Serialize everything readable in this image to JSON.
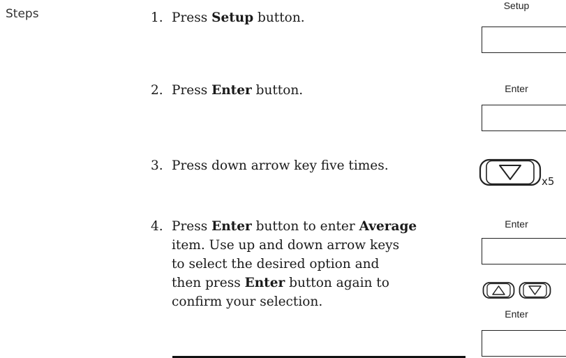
{
  "section": {
    "label": "Steps"
  },
  "steps": [
    {
      "number": "1.",
      "text_parts": [
        "Press ",
        "Setup",
        " button."
      ]
    },
    {
      "number": "2.",
      "text_parts": [
        "Press ",
        "Enter",
        " button."
      ]
    },
    {
      "number": "3.",
      "text_parts": [
        "Press down arrow key five times."
      ]
    },
    {
      "number": "4.",
      "lines": [
        [
          "Press ",
          "Enter",
          " button to enter ",
          "Average"
        ],
        [
          "item. Use up and down arrow keys"
        ],
        [
          "to select the desired option and"
        ],
        [
          "then press ",
          "Enter",
          " button again to"
        ],
        [
          "confirm your selection."
        ]
      ]
    }
  ],
  "keys": {
    "setup_label": "Setup",
    "enter_label_1": "Enter",
    "enter_label_2": "Enter",
    "enter_label_3": "Enter",
    "repeat_count": "x5",
    "down_arrow_icon": "down-arrow-key-icon",
    "up_arrow_icon": "up-arrow-key-icon"
  }
}
